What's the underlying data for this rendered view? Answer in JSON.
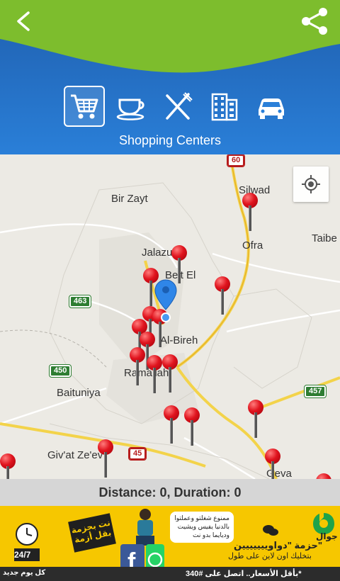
{
  "header": {
    "back_icon": "back-chevron-icon",
    "share_icon": "share-icon",
    "colors": {
      "primary": "#2a7fd8",
      "accent": "#7dbd2d"
    }
  },
  "categories": [
    {
      "key": "shopping",
      "icon": "cart-icon",
      "active": true
    },
    {
      "key": "cafe",
      "icon": "coffee-cup-icon",
      "active": false
    },
    {
      "key": "restaurant",
      "icon": "fork-knife-icon",
      "active": false
    },
    {
      "key": "hotel",
      "icon": "building-icon",
      "active": false
    },
    {
      "key": "car",
      "icon": "car-icon",
      "active": false
    }
  ],
  "category_title": "Shopping Centers",
  "map": {
    "places": {
      "bir_zayt": "Bir Zayt",
      "silwad": "Silwad",
      "taibe": "Taibe",
      "ofra": "Ofra",
      "jalazun": "Jalazu",
      "beit_el": "Beit El",
      "al_bireh": "Al-Bireh",
      "ramallah": "Ramallah",
      "baituniya": "Baituniya",
      "givat_zeev": "Giv'at Ze'ev",
      "geva": "Geva"
    },
    "routes": {
      "r60": "60",
      "r463": "463",
      "r450": "450",
      "r457": "457",
      "r45": "45"
    },
    "locate_icon": "my-location-icon",
    "pin_icon": "red-pushpin-icon",
    "current_location_icon": "blue-location-marker-icon"
  },
  "status": {
    "text": "Distance: 0, Duration: 0"
  },
  "ad": {
    "badge": "24/7",
    "banner": "نت بحزمة بقل أزمة",
    "bubble": "ممنوع شغلتو وعملتوا بالدنيا يفيس ويشيت وديايما بدو نت",
    "headline": "حزمة \"دواوييييييين\"",
    "subline": "بتخليك اون لاين على طول",
    "brand": "جوال",
    "bottom_left": "كل يوم جديد",
    "bottom_right": "بأقل الأسعار.. اتصل على #340*"
  }
}
